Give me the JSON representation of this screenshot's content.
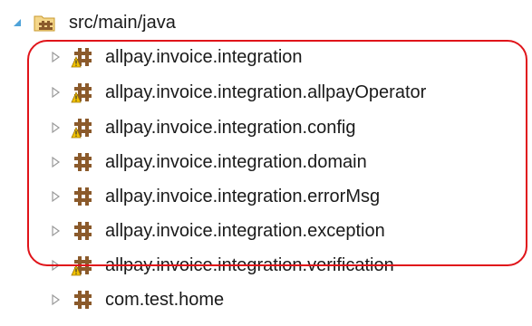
{
  "tree": {
    "root": {
      "label": "src/main/java",
      "icon": "source-folder-icon",
      "expanded": true
    },
    "packages": [
      {
        "label": "allpay.invoice.integration",
        "icon": "package-icon",
        "warning": true
      },
      {
        "label": "allpay.invoice.integration.allpayOperator",
        "icon": "package-icon",
        "warning": true
      },
      {
        "label": "allpay.invoice.integration.config",
        "icon": "package-icon",
        "warning": true
      },
      {
        "label": "allpay.invoice.integration.domain",
        "icon": "package-icon",
        "warning": false
      },
      {
        "label": "allpay.invoice.integration.errorMsg",
        "icon": "package-icon",
        "warning": false
      },
      {
        "label": "allpay.invoice.integration.exception",
        "icon": "package-icon",
        "warning": false
      },
      {
        "label": "allpay.invoice.integration.verification",
        "icon": "package-icon",
        "warning": true
      },
      {
        "label": "com.test.home",
        "icon": "package-icon",
        "warning": false
      }
    ]
  },
  "colors": {
    "highlight": "#e0141a",
    "package_brown": "#8b5a2b",
    "warning_yellow": "#f2c200",
    "expand_arrow": "#4fa3d9",
    "collapse_arrow": "#9a9a9a"
  }
}
